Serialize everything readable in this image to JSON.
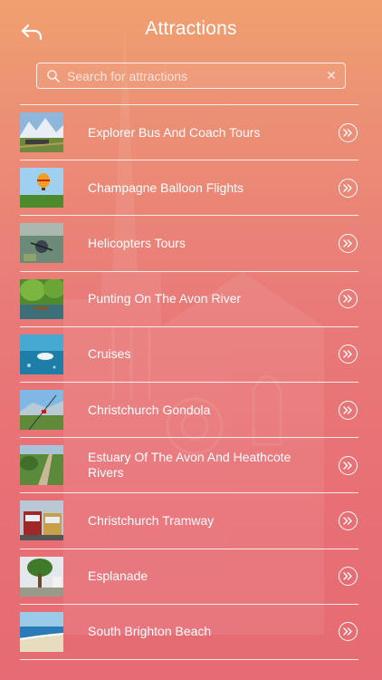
{
  "header": {
    "title": "Attractions",
    "back_icon": "back-arrow-icon"
  },
  "search": {
    "placeholder": "Search for attractions",
    "value": ""
  },
  "colors": {
    "background_top": "#f0a070",
    "background_bottom": "#e66b74",
    "text": "#ffffff"
  },
  "items": [
    {
      "label": "Explorer Bus And Coach Tours",
      "thumb": "train-mountains"
    },
    {
      "label": "Champagne Balloon Flights",
      "thumb": "hot-air-balloon"
    },
    {
      "label": "Helicopters Tours",
      "thumb": "aerial-view"
    },
    {
      "label": "Punting On The Avon River",
      "thumb": "river-trees"
    },
    {
      "label": "Cruises",
      "thumb": "underwater-boat"
    },
    {
      "label": "Christchurch Gondola",
      "thumb": "gondola-hills"
    },
    {
      "label": "Estuary Of The Avon And Heathcote Rivers",
      "thumb": "estuary-path"
    },
    {
      "label": "Christchurch Tramway",
      "thumb": "tram"
    },
    {
      "label": "Esplanade",
      "thumb": "esplanade-palms"
    },
    {
      "label": "South Brighton Beach",
      "thumb": "beach"
    }
  ]
}
